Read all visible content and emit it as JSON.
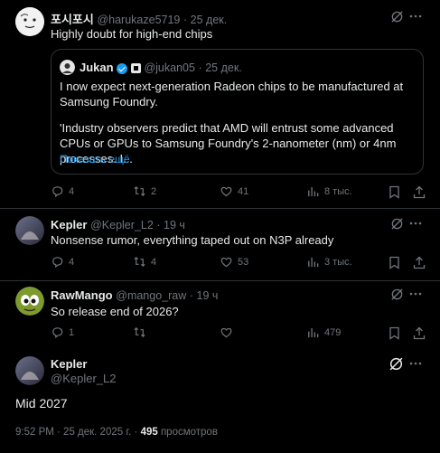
{
  "posts": [
    {
      "display_name": "포시포시",
      "handle": "@harukaze5719",
      "date": "· 25 дек.",
      "text": "Highly doubt for high-end chips",
      "quote": {
        "display_name": "Jukan",
        "handle": "@jukan05",
        "date": "· 25 дек.",
        "text1": "I now expect next-generation Radeon chips to be manufactured at Samsung Foundry.",
        "text2": "'Industry observers predict that AMD will entrust some advanced CPUs or GPUs to Samsung Foundry's 2-nanometer (nm) or 4nm processes. I...",
        "show_more": "Показать ещё"
      },
      "actions": {
        "replies": "4",
        "reposts": "2",
        "likes": "41",
        "views": "8 тыс."
      }
    },
    {
      "display_name": "Kepler",
      "handle": "@Kepler_L2",
      "date": "· 19 ч",
      "text": "Nonsense rumor, everything taped out on N3P already",
      "actions": {
        "replies": "4",
        "reposts": "4",
        "likes": "53",
        "views": "3 тыс."
      }
    },
    {
      "display_name": "RawMango",
      "handle": "@mango_raw",
      "date": "· 19 ч",
      "text": "So release end of 2026?",
      "actions": {
        "replies": "1",
        "reposts": "",
        "likes": "",
        "views": "479"
      }
    }
  ],
  "main": {
    "display_name": "Kepler",
    "handle": "@Kepler_L2",
    "text": "Mid 2027",
    "timestamp": "9:52 PM · 25 дек. 2025 г. ·",
    "views_count": "495",
    "views_label": "просмотров"
  },
  "colors": {
    "accent": "#1d9bf0",
    "muted": "#71767b",
    "text": "#e7e9ea",
    "border": "#2f3336"
  }
}
